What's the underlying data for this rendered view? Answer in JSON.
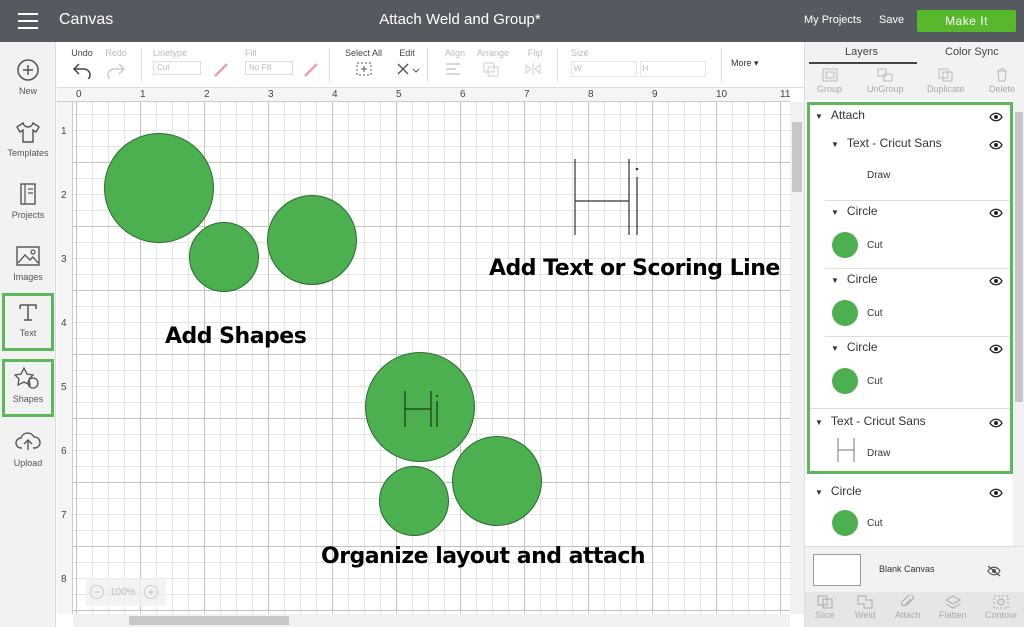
{
  "topbar": {
    "app_name": "Canvas",
    "doc_title": "Attach Weld and Group*",
    "my_projects": "My Projects",
    "save": "Save",
    "make_it": "Make It"
  },
  "sidebar": {
    "items": [
      {
        "label": "New",
        "icon": "plus-circle-icon",
        "highlighted": false
      },
      {
        "label": "Templates",
        "icon": "shirt-icon",
        "highlighted": false
      },
      {
        "label": "Projects",
        "icon": "book-icon",
        "highlighted": false
      },
      {
        "label": "Images",
        "icon": "image-icon",
        "highlighted": false
      },
      {
        "label": "Text",
        "icon": "text-t-icon",
        "highlighted": true
      },
      {
        "label": "Shapes",
        "icon": "shapes-icon",
        "highlighted": true
      },
      {
        "label": "Upload",
        "icon": "cloud-upload-icon",
        "highlighted": false
      }
    ]
  },
  "toolbar": {
    "undo": "Undo",
    "redo": "Redo",
    "linetype": "Linetype",
    "linetype_value": "Cut",
    "fill": "Fill",
    "fill_value": "No Fill",
    "select_all": "Select All",
    "edit": "Edit",
    "align": "Align",
    "arrange": "Arrange",
    "flip": "Flip",
    "size": "Size",
    "size_w": "W",
    "size_h": "H",
    "more": "More"
  },
  "ruler": {
    "top": [
      "0",
      "1",
      "2",
      "3",
      "4",
      "5",
      "6",
      "7",
      "8",
      "9",
      "10",
      "11"
    ],
    "left": [
      "1",
      "2",
      "3",
      "4",
      "5",
      "6",
      "7",
      "8"
    ]
  },
  "canvas": {
    "captions": {
      "add_shapes": "Add Shapes",
      "add_text": "Add Text or Scoring Line",
      "organize": "Organize layout and attach"
    },
    "zoom_level": "100%"
  },
  "right_panel": {
    "tabs": [
      "Layers",
      "Color Sync"
    ],
    "layer_tools": [
      "Group",
      "UnGroup",
      "Duplicate",
      "Delete"
    ],
    "attach_group": {
      "label": "Attach",
      "children": [
        {
          "label": "Text - Cricut Sans",
          "sub": "Draw"
        },
        {
          "label": "Circle",
          "sub": "Cut"
        },
        {
          "label": "Circle",
          "sub": "Cut"
        },
        {
          "label": "Circle",
          "sub": "Cut"
        }
      ]
    },
    "text_layer": {
      "label": "Text - Cricut Sans",
      "sub": "Draw"
    },
    "circle_layer": {
      "label": "Circle",
      "sub": "Cut"
    },
    "blank_canvas": "Blank Canvas",
    "bottom_tools": [
      "Slice",
      "Weld",
      "Attach",
      "Flatten",
      "Contour"
    ]
  },
  "colors": {
    "accent_green": "#58b82c",
    "shape_green": "#4caf50",
    "topbar": "#545a5f",
    "highlight_outline": "#5cb85c"
  }
}
